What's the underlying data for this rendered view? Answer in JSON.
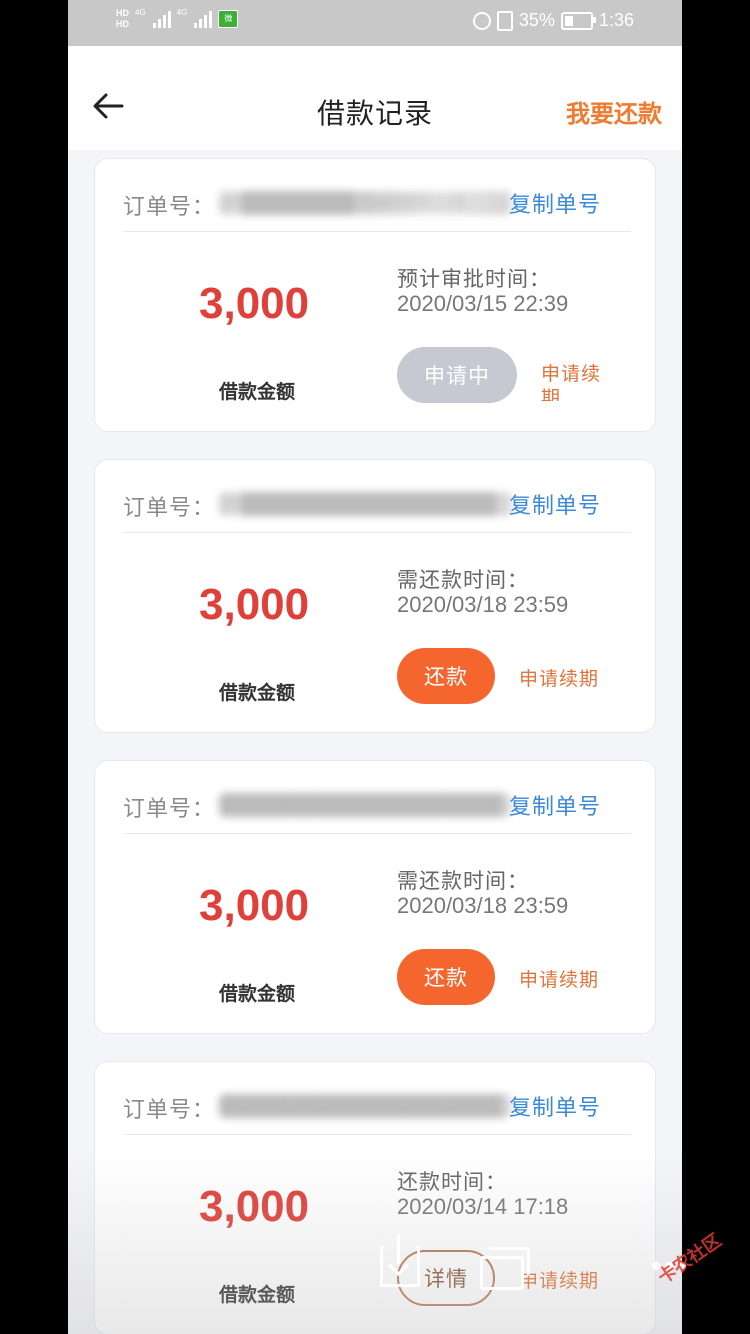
{
  "status_bar": {
    "hd_top": "HD",
    "hd_bottom": "HD",
    "net1": "4G",
    "net2": "4G",
    "app_badge": "微",
    "battery_percent": "35%",
    "battery_level": 0.35,
    "time": "1:36"
  },
  "header": {
    "title": "借款记录",
    "repay_link": "我要还款",
    "back_icon": "arrow-left-icon"
  },
  "records": [
    {
      "order_label": "订单号：",
      "order_number": "20████████3040005225",
      "copy_label": "复制单号",
      "amount": "3,000",
      "amount_label": "借款金额",
      "time_label": "预计审批时间：",
      "time_value": "2020/03/15 22:39",
      "button_label": "申请中",
      "button_state": "pending",
      "extend_label": "申请续期"
    },
    {
      "order_label": "订单号：",
      "order_number": "20██████████████████",
      "copy_label": "复制单号",
      "amount": "3,000",
      "amount_label": "借款金额",
      "time_label": "需还款时间：",
      "time_value": "2020/03/18 23:59",
      "button_label": "还款",
      "button_state": "active",
      "extend_label": "申请续期"
    },
    {
      "order_label": "订单号：",
      "order_number": "████████████████████",
      "copy_label": "复制单号",
      "amount": "3,000",
      "amount_label": "借款金额",
      "time_label": "需还款时间：",
      "time_value": "2020/03/18 23:59",
      "button_label": "还款",
      "button_state": "active",
      "extend_label": "申请续期"
    },
    {
      "order_label": "订单号：",
      "order_number": "████████████████████",
      "copy_label": "复制单号",
      "amount": "3,000",
      "amount_label": "借款金额",
      "time_label": "还款时间：",
      "time_value": "2020/03/14 17:18",
      "button_label": "详情",
      "button_state": "outline",
      "extend_label": "申请续期"
    }
  ],
  "overlay": {
    "download_icon": "download-icon",
    "pip_icon": "picture-in-picture-icon",
    "more_icon": "more-dots-icon",
    "watermark": "卡农社区"
  },
  "colors": {
    "accent_orange": "#f5662e",
    "amount_red": "#e0403a",
    "link_blue": "#3b8ad9",
    "pending_gray": "#c7c9d2"
  }
}
